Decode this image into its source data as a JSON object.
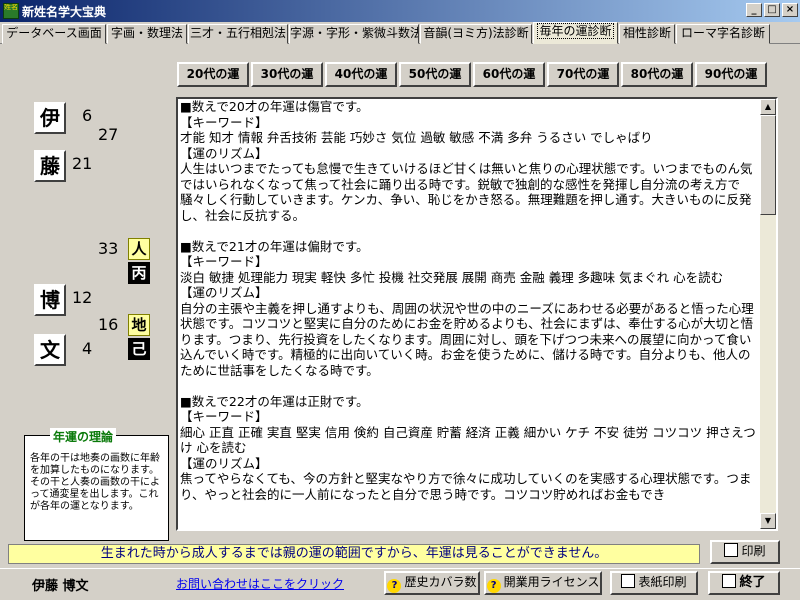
{
  "window": {
    "icon_text": "姓名",
    "title": "新姓名学大宝典",
    "min_label": "_",
    "max_label": "□",
    "close_label": "×"
  },
  "tabs": [
    {
      "label": "データベース画面",
      "active": false
    },
    {
      "label": "字画・数理法",
      "active": false
    },
    {
      "label": "三才・五行相剋法",
      "active": false
    },
    {
      "label": "字源・字形・紫微斗数法",
      "active": false
    },
    {
      "label": "音韻(ヨミ方)法診断",
      "active": false
    },
    {
      "label": "毎年の運診断",
      "active": true
    },
    {
      "label": "相性診断",
      "active": false
    },
    {
      "label": "ローマ字名診断",
      "active": false
    }
  ],
  "age_buttons": [
    "20代の運",
    "30代の運",
    "40代の運",
    "50代の運",
    "60代の運",
    "70代の運",
    "80代の運",
    "90代の運"
  ],
  "name_chart": {
    "chars": [
      {
        "kanji": "伊",
        "strokes": "6"
      },
      {
        "kanji": "藤",
        "strokes": "21"
      },
      {
        "kanji": "博",
        "strokes": "12"
      },
      {
        "kanji": "文",
        "strokes": "4"
      }
    ],
    "sum_top": "27",
    "jin_value": "33",
    "jin_label": "人",
    "jin_stem": "丙",
    "chi_value": "16",
    "chi_label": "地",
    "chi_stem": "己"
  },
  "theory": {
    "title": "年運の理論",
    "body": "各年の干は地奏の画数に年齢を加算したものになります。その干と人奏の画数の干によって通変星を出します。これが各年の運となります。"
  },
  "fortune_lines": [
    "■数えで20才の年運は傷官です。",
    "【キーワード】",
    "才能 知才 情報 弁舌技術 芸能 巧妙さ 気位 過敏 敏感 不満 多弁 うるさい でしゃばり",
    "【運のリズム】",
    "人生はいつまでたっても怠慢で生きていけるほど甘くは無いと焦りの心理状態です。いつまでものん気ではいられなくなって焦って社会に踊り出る時です。鋭敏で独創的な感性を発揮し自分流の考え方で騒々しく行動していきます。ケンカ、争い、恥じをかき怒る。無理難題を押し通す。大きいものに反発し、社会に反抗する。",
    "",
    "■数えで21才の年運は偏財です。",
    "【キーワード】",
    "淡白 敏捷 処理能力 現実 軽快 多忙 投機 社交発展 展開 商売 金融 義理 多趣味 気まぐれ 心を読む",
    "【運のリズム】",
    "自分の主張や主義を押し通すよりも、周囲の状況や世の中のニーズにあわせる必要があると悟った心理状態です。コツコツと堅実に自分のためにお金を貯めるよりも、社会にまずは、奉仕する心が大切と悟ります。つまり、先行投資をしたくなります。周囲に対し、頭を下げつつ未来への展望に向かって食い込んでいく時です。精極的に出向いていく時。お金を使うために、儲ける時です。自分よりも、他人のために世話事をしたくなる時です。",
    "",
    "■数えで22才の年運は正財です。",
    "【キーワード】",
    "細心 正直 正確 実直 堅実 信用 倹約 自己資産 貯蓄 経済 正義 細かい ケチ 不安 徒労 コツコツ 押さえつけ 心を読む",
    "【運のリズム】",
    "焦ってやらなくても、今の方針と堅実なやり方で徐々に成功していくのを実感する心理状態です。つまり、やっと社会的に一人前になったと自分で思う時です。コツコツ貯めればお金もでき"
  ],
  "status_text": "生まれた時から成人するまでは親の運の範囲ですから、年運は見ることができません。",
  "print_button": "印刷",
  "footer": {
    "user_name": "伊藤 博文",
    "contact_link": "お問い合わせはここをクリック",
    "history_button": "歴史カバラ数",
    "license_button": "開業用ライセンス",
    "cover_print_button": "表紙印刷",
    "exit_button": "終了"
  },
  "scroll": {
    "up": "▲",
    "down": "▼"
  }
}
